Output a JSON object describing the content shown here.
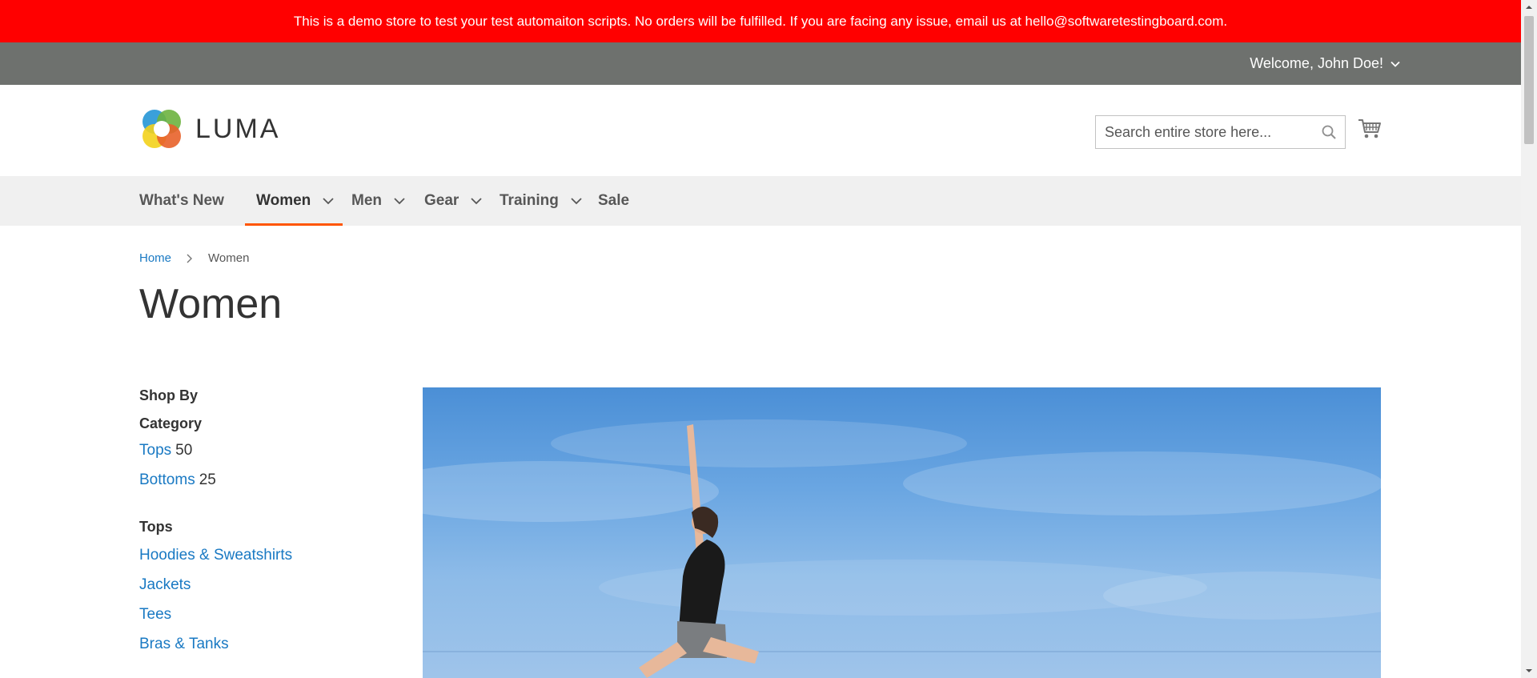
{
  "banner": {
    "text": "This is a demo store to test your test automaiton scripts. No orders will be fulfilled. If you are facing any issue, email us at hello@softwaretestingboard.com."
  },
  "top_bar": {
    "welcome": "Welcome, John Doe!"
  },
  "header": {
    "logo_text": "LUMA",
    "search_placeholder": "Search entire store here..."
  },
  "nav": {
    "items": [
      {
        "label": "What's New",
        "has_dropdown": false
      },
      {
        "label": "Women",
        "has_dropdown": true,
        "active": true
      },
      {
        "label": "Men",
        "has_dropdown": true
      },
      {
        "label": "Gear",
        "has_dropdown": true
      },
      {
        "label": "Training",
        "has_dropdown": true
      },
      {
        "label": "Sale",
        "has_dropdown": false
      }
    ]
  },
  "breadcrumb": {
    "home": "Home",
    "current": "Women"
  },
  "page": {
    "title": "Women"
  },
  "sidebar": {
    "shop_by": "Shop By",
    "category_title": "Category",
    "categories": [
      {
        "label": "Tops",
        "count": "50"
      },
      {
        "label": "Bottoms",
        "count": "25"
      }
    ],
    "tops_title": "Tops",
    "tops_links": [
      {
        "label": "Hoodies & Sweatshirts"
      },
      {
        "label": "Jackets"
      },
      {
        "label": "Tees"
      },
      {
        "label": "Bras & Tanks"
      }
    ]
  },
  "colors": {
    "banner_bg": "#ff0000",
    "top_bar_bg": "#6e716e",
    "nav_bg": "#f0f0f0",
    "accent": "#ff5501",
    "link": "#1979c3"
  }
}
